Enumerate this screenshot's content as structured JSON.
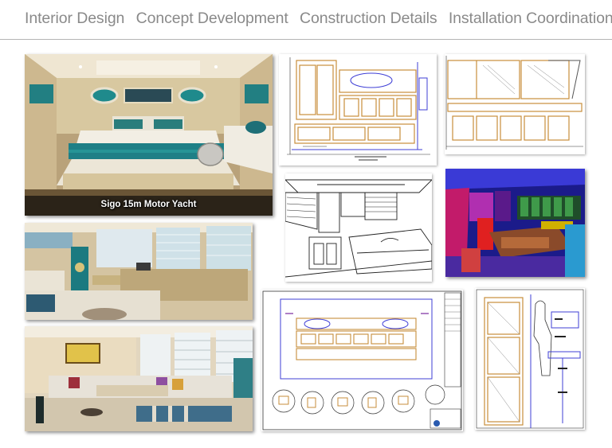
{
  "header": {
    "sections": [
      "Interior Design",
      "Concept Development",
      "Construction Details",
      "Installation Coordination"
    ]
  },
  "bedroom_render": {
    "caption": "Sigo 15m Motor Yacht"
  },
  "colors": {
    "wood": "#d9c9a4",
    "teal": "#1f8a8c",
    "cabinet": "#c9913f",
    "cad_blue": "#3f3fd6"
  }
}
